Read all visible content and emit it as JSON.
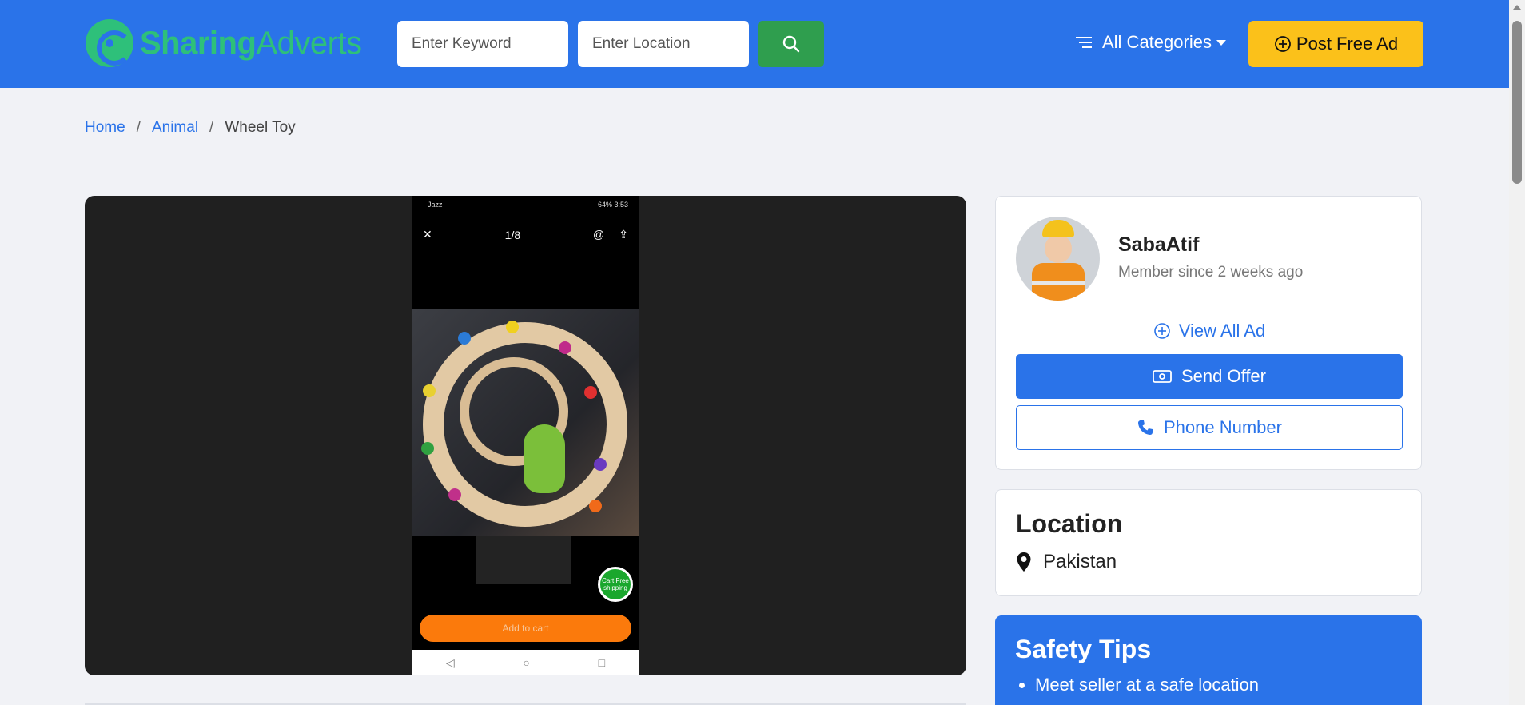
{
  "header": {
    "logo_part1": "Sharing",
    "logo_part2": "Adverts",
    "keyword_placeholder": "Enter Keyword",
    "location_placeholder": "Enter Location",
    "categories_label": "All Categories",
    "post_ad_label": "Post Free Ad",
    "brand_color": "#2a73e9",
    "accent_color": "#fbc11a",
    "search_color": "#2f9e4e"
  },
  "breadcrumb": {
    "items": [
      {
        "label": "Home"
      },
      {
        "label": "Animal"
      }
    ],
    "current": "Wheel Toy",
    "separator": "/"
  },
  "gallery": {
    "status_left": "Jazz",
    "status_right": "64% 3:53",
    "counter": "1/8",
    "cart_badge": "Cart Free shipping",
    "add_to_cart": "Add to cart"
  },
  "seller": {
    "name": "SabaAtif",
    "member_since": "Member since 2 weeks ago",
    "view_all_label": "View All Ad",
    "send_offer_label": "Send Offer",
    "phone_label": "Phone Number"
  },
  "location": {
    "title": "Location",
    "value": "Pakistan"
  },
  "safety": {
    "title": "Safety Tips",
    "tips": [
      "Meet seller at a safe location"
    ]
  }
}
